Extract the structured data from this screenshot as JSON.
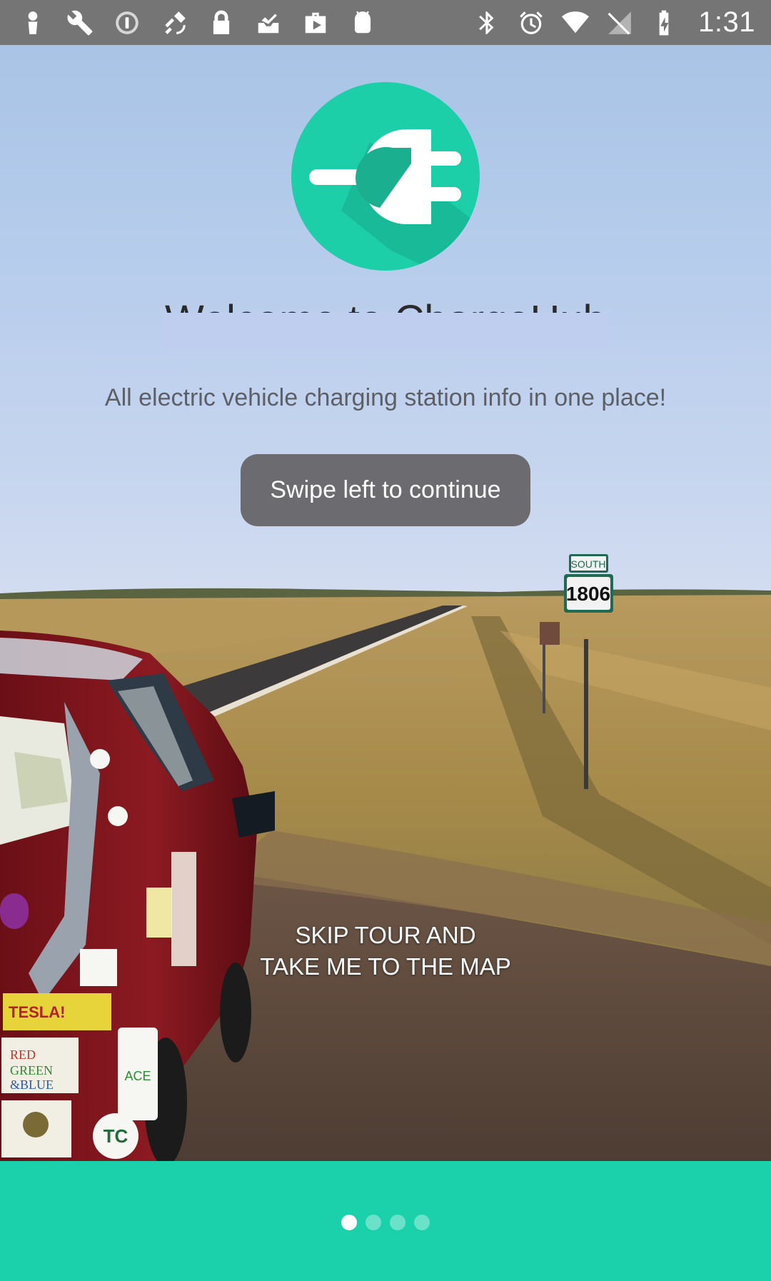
{
  "status_bar": {
    "time": "1:31",
    "left_icons": [
      "person-icon",
      "wrench-icon",
      "info-icon",
      "fake-gps-icon",
      "lock-icon",
      "inbox-icon",
      "play-store-icon",
      "android-icon"
    ],
    "right_icons": [
      "bluetooth-icon",
      "alarm-icon",
      "wifi-icon",
      "signal-icon",
      "battery-charging-icon"
    ]
  },
  "logo": {
    "icon": "plug-icon",
    "color": "#1ccfa9"
  },
  "welcome": {
    "title": "Welcome to ChargeHub",
    "tagline": "All electric vehicle charging station info in one place!"
  },
  "swipe_button": {
    "label": "Swipe left to continue"
  },
  "skip_link": {
    "line1": "SKIP TOUR AND",
    "line2": "TAKE ME TO THE MAP"
  },
  "pager": {
    "total": 4,
    "current": 1
  },
  "colors": {
    "accent": "#1bd1ac",
    "button": "#6c6c70",
    "status_bar": "#757575"
  }
}
